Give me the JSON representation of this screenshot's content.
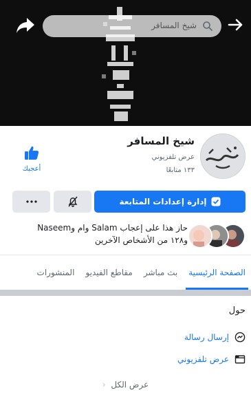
{
  "header": {
    "search_placeholder": "شيخ المسافر",
    "icons": {
      "back": "arrow-right-icon",
      "share": "share-arrow-icon",
      "search": "search-icon"
    }
  },
  "profile": {
    "name": "شيخ المسافر",
    "category": "عرض تلفزيوني",
    "followers": "١٣٣ متابعًا",
    "like_label": "أعجبك"
  },
  "actions": {
    "follow_settings_label": "إدارة إعدادات المتابعة"
  },
  "liked_by": {
    "line1": "حاز هذا على إعجاب Salam وام وNaseem",
    "line2": "و١٢٨ من الأشخاص الآخرين"
  },
  "tabs": [
    {
      "label": "الصفحة الرئيسية",
      "active": true
    },
    {
      "label": "بث مباشر",
      "active": false
    },
    {
      "label": "مقاطع الفيديو",
      "active": false
    },
    {
      "label": "المنشورات",
      "active": false
    }
  ],
  "about": {
    "title": "حول",
    "send_message": "إرسال رسالة",
    "category": "عرض تلفزيوني",
    "see_all": "عرض الكل"
  },
  "colors": {
    "accent": "#1877f2",
    "button_gray": "#e4e6eb",
    "text": "#1c1e21",
    "muted": "#606770"
  }
}
